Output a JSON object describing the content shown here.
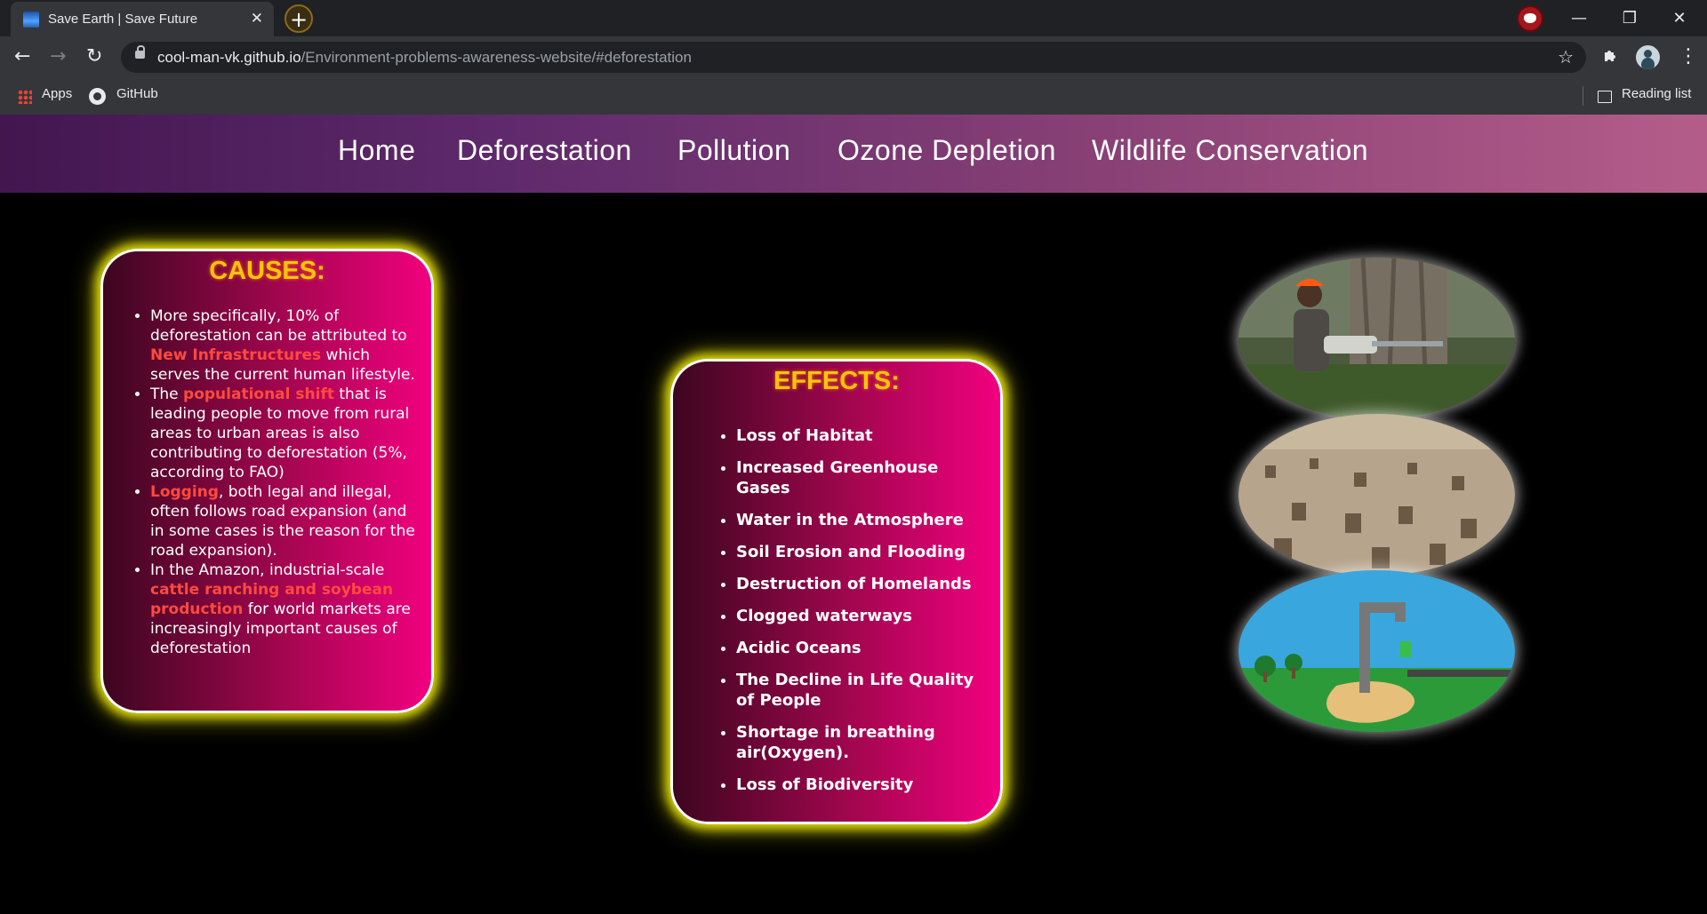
{
  "browser": {
    "tab_title": "Save Earth | Save Future",
    "tab_close": "✕",
    "new_tab": "+",
    "url_host": "cool-man-vk.github.io",
    "url_path": "/Environment-problems-awareness-website/#deforestation",
    "win_min": "—",
    "win_restore": "❐",
    "win_close": "✕",
    "back": "←",
    "forward": "→",
    "reload": "↻",
    "star": "☆",
    "menu": "⋮",
    "bookmarks": {
      "apps": "Apps",
      "github": "GitHub",
      "reading_list": "Reading list"
    }
  },
  "nav": {
    "items": [
      "Home",
      "Deforestation",
      "Pollution",
      "Ozone Depletion",
      "Wildlife Conservation"
    ]
  },
  "causes": {
    "title": "CAUSES:",
    "items": [
      {
        "before": "More specifically, 10% of deforestation can be attributed to ",
        "highlight": "New Infrastructures",
        "after": " which serves the current human lifestyle."
      },
      {
        "before": "The ",
        "highlight": "populational shift",
        "after": " that is leading people to move from rural areas to urban areas is also contributing to deforestation (5%, according to FAO)"
      },
      {
        "before": "",
        "highlight": "Logging",
        "after": ", both legal and illegal, often follows road expansion (and in some cases is the reason for the road expansion)."
      },
      {
        "before": "In the Amazon, industrial-scale ",
        "highlight": "cattle ranching and soybean production",
        "after": " for world markets are increasingly important causes of deforestation"
      }
    ]
  },
  "effects": {
    "title": "EFFECTS:",
    "items": [
      "Loss of Habitat",
      "Increased Greenhouse Gases",
      "Water in the Atmosphere",
      "Soil Erosion and Flooding",
      "Destruction of Homelands",
      "Clogged waterways",
      "Acidic Oceans",
      "The Decline in Life Quality of People",
      "Shortage in breathing air(Oxygen).",
      "Loss of Biodiversity"
    ]
  },
  "images": [
    {
      "name": "logger-chainsaw-image",
      "subject": "man cutting tree with chainsaw"
    },
    {
      "name": "tree-stumps-image",
      "subject": "field of tree stumps"
    },
    {
      "name": "dry-tap-illustration",
      "subject": "tap over dry land with money"
    }
  ]
}
